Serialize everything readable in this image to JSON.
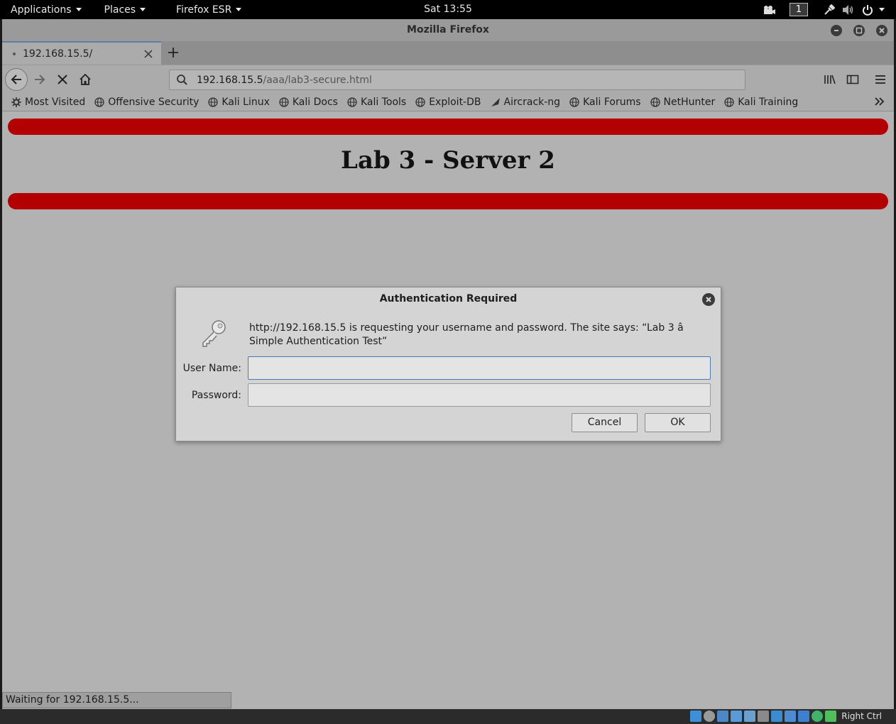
{
  "topbar": {
    "applications_label": "Applications",
    "places_label": "Places",
    "firefox_label": "Firefox ESR",
    "clock": "Sat 13:55",
    "workspace_number": "1"
  },
  "window": {
    "title": "Mozilla Firefox"
  },
  "tabs": [
    {
      "title": "192.168.15.5/"
    }
  ],
  "navbar": {
    "url_host": "192.168.15.5",
    "url_path": "/aaa/lab3-secure.html"
  },
  "bookmarks": [
    {
      "label": "Most Visited",
      "icon": "gear-icon"
    },
    {
      "label": "Offensive Security",
      "icon": "globe-icon"
    },
    {
      "label": "Kali Linux",
      "icon": "globe-icon"
    },
    {
      "label": "Kali Docs",
      "icon": "globe-icon"
    },
    {
      "label": "Kali Tools",
      "icon": "globe-icon"
    },
    {
      "label": "Exploit-DB",
      "icon": "globe-icon"
    },
    {
      "label": "Aircrack-ng",
      "icon": "aircrack-icon"
    },
    {
      "label": "Kali Forums",
      "icon": "globe-icon"
    },
    {
      "label": "NetHunter",
      "icon": "globe-icon"
    },
    {
      "label": "Kali Training",
      "icon": "globe-icon"
    }
  ],
  "page": {
    "heading": "Lab 3 - Server 2",
    "accent_color": "#b30000"
  },
  "dialog": {
    "title": "Authentication Required",
    "message": "http://192.168.15.5 is requesting your username and password. The site says: “Lab 3 â Simple Authentication Test”",
    "username_label": "User Name:",
    "password_label": "Password:",
    "username_value": "",
    "password_value": "",
    "cancel_label": "Cancel",
    "ok_label": "OK"
  },
  "status": {
    "text": "Waiting for 192.168.15.5..."
  },
  "vbox": {
    "host_key": "Right Ctrl"
  }
}
